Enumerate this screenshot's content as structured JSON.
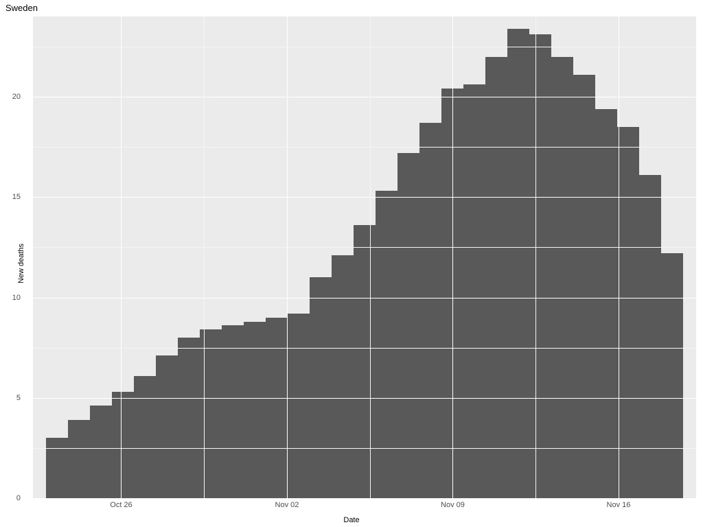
{
  "chart_data": {
    "type": "bar",
    "title": "Sweden",
    "xlabel": "Date",
    "ylabel": "New deaths",
    "ylim": [
      0,
      24
    ],
    "y_breaks": [
      0,
      5,
      10,
      15,
      20
    ],
    "y_minor": [
      2.5,
      7.5,
      12.5,
      17.5,
      22.5
    ],
    "x_breaks": [
      {
        "f": 0.133,
        "label": "Oct 26"
      },
      {
        "f": 0.383,
        "label": "Nov 02"
      },
      {
        "f": 0.633,
        "label": "Nov 09"
      },
      {
        "f": 0.883,
        "label": "Nov 16"
      }
    ],
    "x_minor": [
      0.258,
      0.508,
      0.758
    ],
    "bar_color": "#595959",
    "categories": [
      "Oct 22",
      "Oct 23",
      "Oct 24",
      "Oct 25",
      "Oct 26",
      "Oct 27",
      "Oct 28",
      "Oct 29",
      "Oct 30",
      "Oct 31",
      "Nov 01",
      "Nov 02",
      "Nov 03",
      "Nov 04",
      "Nov 05",
      "Nov 06",
      "Nov 07",
      "Nov 08",
      "Nov 09",
      "Nov 10",
      "Nov 11",
      "Nov 12",
      "Nov 13",
      "Nov 14",
      "Nov 15",
      "Nov 16",
      "Nov 17",
      "Nov 18",
      "Nov 19"
    ],
    "values": [
      3.0,
      3.9,
      4.6,
      5.3,
      6.1,
      7.1,
      8.0,
      8.4,
      8.6,
      8.8,
      9.0,
      9.2,
      11.0,
      12.1,
      13.6,
      15.3,
      17.2,
      18.7,
      20.4,
      20.6,
      22.0,
      23.4,
      23.1,
      22.0,
      21.1,
      19.4,
      18.5,
      16.1,
      12.2
    ]
  },
  "panel_bg": "#ebebeb",
  "grid_major_color": "#ffffff"
}
